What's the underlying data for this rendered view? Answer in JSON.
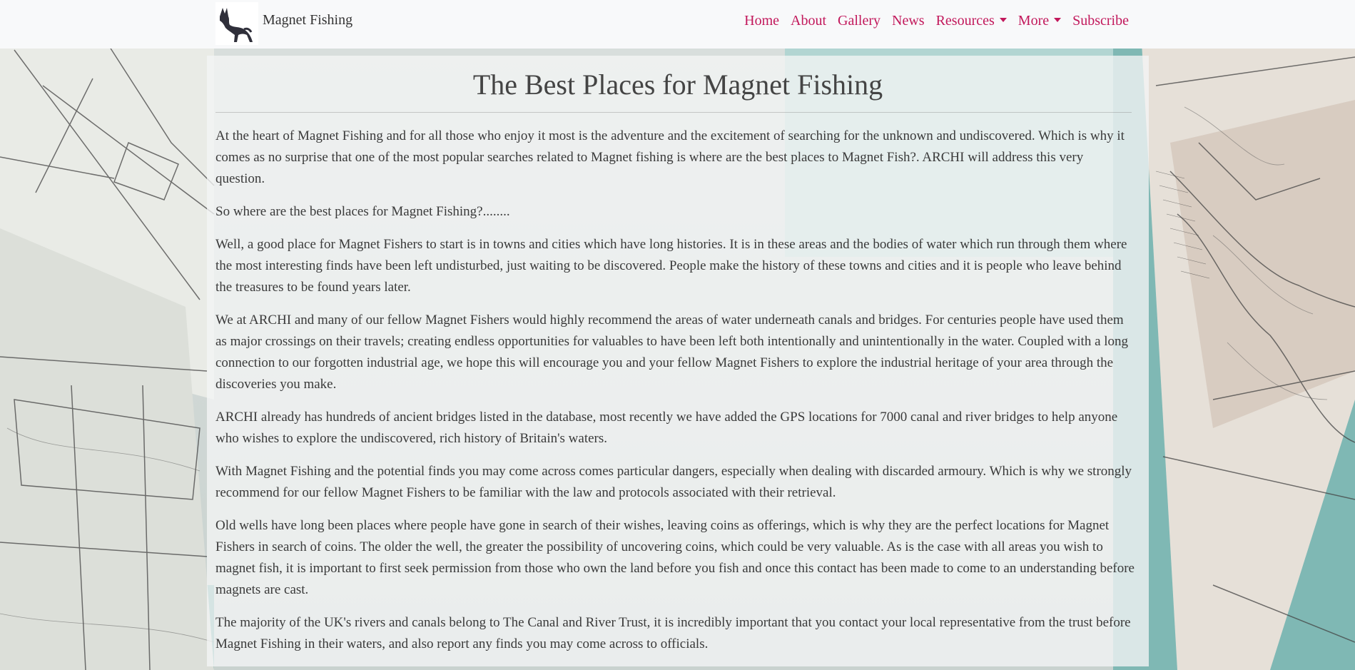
{
  "brand": {
    "name": "Magnet Fishing",
    "logo_icon": "black-dog-icon"
  },
  "nav": {
    "items": [
      {
        "label": "Home",
        "dropdown": false
      },
      {
        "label": "About",
        "dropdown": false
      },
      {
        "label": "Gallery",
        "dropdown": false
      },
      {
        "label": "News",
        "dropdown": false
      },
      {
        "label": "Resources",
        "dropdown": true
      },
      {
        "label": "More",
        "dropdown": true
      },
      {
        "label": "Subscribe",
        "dropdown": false
      }
    ]
  },
  "article": {
    "title": "The Best Places for Magnet Fishing",
    "paragraphs": [
      "At the heart of Magnet Fishing and for all those who enjoy it most is the adventure and the excitement of searching for the unknown and undiscovered. Which is why it comes as no surprise that one of the most popular searches related to Magnet fishing is where are the best places to Magnet Fish?. ARCHI will address this very question.",
      "So where are the best places for Magnet Fishing?........",
      "Well, a good place for Magnet Fishers to start is in towns and cities which have long histories. It is in these areas and the bodies of water which run through them where the most interesting finds have been left undisturbed, just waiting to be discovered. People make the history of these towns and cities and it is people who leave behind the treasures to be found years later.",
      "We at ARCHI and many of our fellow Magnet Fishers would highly recommend the areas of water underneath canals and bridges. For centuries people have used them as major crossings on their travels; creating endless opportunities for valuables to have been left both intentionally and unintentionally in the water. Coupled with a long connection to our forgotten industrial age, we hope this will encourage you and your fellow Magnet Fishers to explore the industrial heritage of your area through the discoveries you make.",
      "ARCHI already has hundreds of ancient bridges listed in the database, most recently we have added the GPS locations for 7000 canal and river bridges to help anyone who wishes to explore the undiscovered, rich history of Britain's waters.",
      "With Magnet Fishing and the potential finds you may come across comes particular dangers, especially when dealing with discarded armoury. Which is why we strongly recommend for our fellow Magnet Fishers to be familiar with the law and protocols associated with their retrieval.",
      "Old wells have long been places where people have gone in search of their wishes, leaving coins as offerings, which is why they are the perfect locations for Magnet Fishers in search of coins. The older the well, the greater the possibility of uncovering coins, which could be very valuable. As is the case with all areas you wish to magnet fish, it is important to first seek permission from those who own the land before you fish and once this contact has been made to come to an understanding before magnets are cast.",
      "The majority of the UK's rivers and canals belong to The Canal and River Trust, it is incredibly important that you contact your local representative from the trust before Magnet Fishing in their waters, and also report any finds you may come across to officials."
    ]
  },
  "colors": {
    "nav_link": "#c2185b",
    "navbar_bg": "#f8f9fa",
    "text": "#3a3a3a",
    "map_teal": "#5fa9a7"
  }
}
